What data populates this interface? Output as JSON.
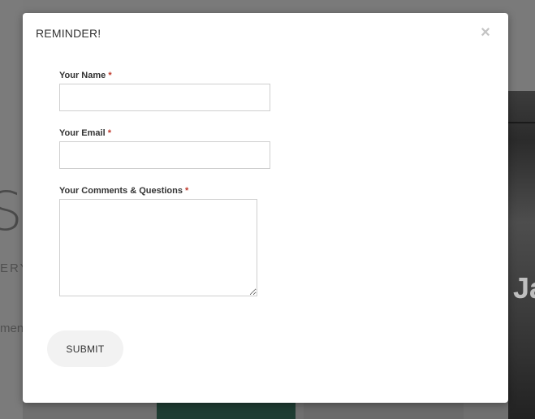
{
  "background": {
    "big_letter": "S",
    "small_text": "ERY",
    "small_text2": "ment",
    "right_text": "Ja"
  },
  "modal": {
    "title": "REMINDER!",
    "close_glyph": "×",
    "fields": [
      {
        "label": "Your Name",
        "required_mark": "*",
        "value": "",
        "placeholder": ""
      },
      {
        "label": "Your Email",
        "required_mark": "*",
        "value": "",
        "placeholder": ""
      },
      {
        "label": "Your Comments & Questions",
        "required_mark": "*",
        "value": "",
        "placeholder": ""
      }
    ],
    "submit_label": "SUBMIT"
  },
  "colors": {
    "overlay": "#6f6f6f",
    "modal_bg": "#ffffff",
    "required": "#c0392b",
    "button_bg": "#f2f2f2"
  }
}
